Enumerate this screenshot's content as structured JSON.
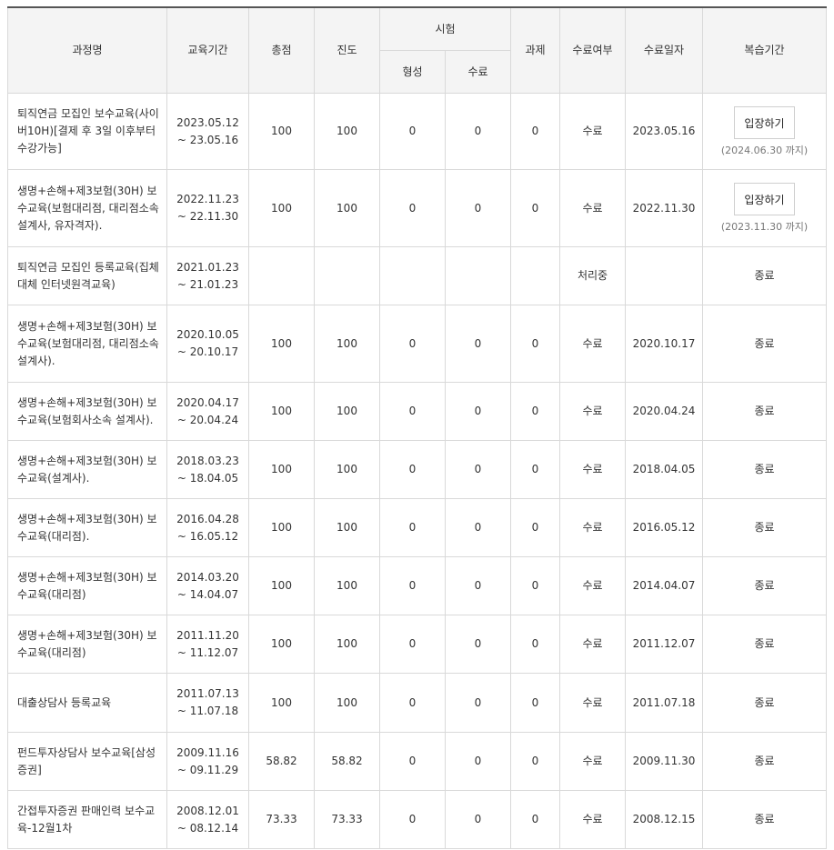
{
  "headers": {
    "course": "과정명",
    "period": "교육기간",
    "total": "총점",
    "progress": "진도",
    "exam": "시험",
    "exam_formative": "형성",
    "exam_final": "수료",
    "assignment": "과제",
    "completion": "수료여부",
    "completion_date": "수료일자",
    "review": "복습기간"
  },
  "rows": [
    {
      "title": "퇴직연금 모집인 보수교육(사이버10H)[결제 후 3일 이후부터 수강가능]",
      "start": "2023.05.12",
      "end": "~ 23.05.16",
      "total": "100",
      "progress": "100",
      "formative": "0",
      "final": "0",
      "assignment": "0",
      "status": "수료",
      "date": "2023.05.16",
      "review_type": "button",
      "review_label": "입장하기",
      "review_note": "(2024.06.30 까지)"
    },
    {
      "title": "생명+손해+제3보험(30H) 보수교육(보험대리점, 대리점소속 설계사, 유자격자).",
      "start": "2022.11.23",
      "end": "~ 22.11.30",
      "total": "100",
      "progress": "100",
      "formative": "0",
      "final": "0",
      "assignment": "0",
      "status": "수료",
      "date": "2022.11.30",
      "review_type": "button",
      "review_label": "입장하기",
      "review_note": "(2023.11.30 까지)"
    },
    {
      "title": "퇴직연금 모집인 등록교육(집체 대체 인터넷원격교육)",
      "start": "2021.01.23",
      "end": "~ 21.01.23",
      "total": "",
      "progress": "",
      "formative": "",
      "final": "",
      "assignment": "",
      "status": "처리중",
      "date": "",
      "review_type": "text",
      "review_label": "종료",
      "review_note": ""
    },
    {
      "title": "생명+손해+제3보험(30H) 보수교육(보험대리점, 대리점소속 설계사).",
      "start": "2020.10.05",
      "end": "~ 20.10.17",
      "total": "100",
      "progress": "100",
      "formative": "0",
      "final": "0",
      "assignment": "0",
      "status": "수료",
      "date": "2020.10.17",
      "review_type": "text",
      "review_label": "종료",
      "review_note": ""
    },
    {
      "title": "생명+손해+제3보험(30H) 보수교육(보험회사소속 설계사).",
      "start": "2020.04.17",
      "end": "~ 20.04.24",
      "total": "100",
      "progress": "100",
      "formative": "0",
      "final": "0",
      "assignment": "0",
      "status": "수료",
      "date": "2020.04.24",
      "review_type": "text",
      "review_label": "종료",
      "review_note": ""
    },
    {
      "title": "생명+손해+제3보험(30H) 보수교육(설계사).",
      "start": "2018.03.23",
      "end": "~ 18.04.05",
      "total": "100",
      "progress": "100",
      "formative": "0",
      "final": "0",
      "assignment": "0",
      "status": "수료",
      "date": "2018.04.05",
      "review_type": "text",
      "review_label": "종료",
      "review_note": ""
    },
    {
      "title": "생명+손해+제3보험(30H) 보수교육(대리점).",
      "start": "2016.04.28",
      "end": "~ 16.05.12",
      "total": "100",
      "progress": "100",
      "formative": "0",
      "final": "0",
      "assignment": "0",
      "status": "수료",
      "date": "2016.05.12",
      "review_type": "text",
      "review_label": "종료",
      "review_note": ""
    },
    {
      "title": "생명+손해+제3보험(30H) 보수교육(대리점)",
      "start": "2014.03.20",
      "end": "~ 14.04.07",
      "total": "100",
      "progress": "100",
      "formative": "0",
      "final": "0",
      "assignment": "0",
      "status": "수료",
      "date": "2014.04.07",
      "review_type": "text",
      "review_label": "종료",
      "review_note": ""
    },
    {
      "title": "생명+손해+제3보험(30H) 보수교육(대리점)",
      "start": "2011.11.20",
      "end": "~ 11.12.07",
      "total": "100",
      "progress": "100",
      "formative": "0",
      "final": "0",
      "assignment": "0",
      "status": "수료",
      "date": "2011.12.07",
      "review_type": "text",
      "review_label": "종료",
      "review_note": ""
    },
    {
      "title": "대출상담사 등록교육",
      "start": "2011.07.13",
      "end": "~ 11.07.18",
      "total": "100",
      "progress": "100",
      "formative": "0",
      "final": "0",
      "assignment": "0",
      "status": "수료",
      "date": "2011.07.18",
      "review_type": "text",
      "review_label": "종료",
      "review_note": ""
    },
    {
      "title": "펀드투자상담사 보수교육[삼성증권]",
      "start": "2009.11.16",
      "end": "~ 09.11.29",
      "total": "58.82",
      "progress": "58.82",
      "formative": "0",
      "final": "0",
      "assignment": "0",
      "status": "수료",
      "date": "2009.11.30",
      "review_type": "text",
      "review_label": "종료",
      "review_note": ""
    },
    {
      "title": "간접투자증권 판매인력 보수교육-12월1차",
      "start": "2008.12.01",
      "end": "~ 08.12.14",
      "total": "73.33",
      "progress": "73.33",
      "formative": "0",
      "final": "0",
      "assignment": "0",
      "status": "수료",
      "date": "2008.12.15",
      "review_type": "text",
      "review_label": "종료",
      "review_note": ""
    }
  ]
}
